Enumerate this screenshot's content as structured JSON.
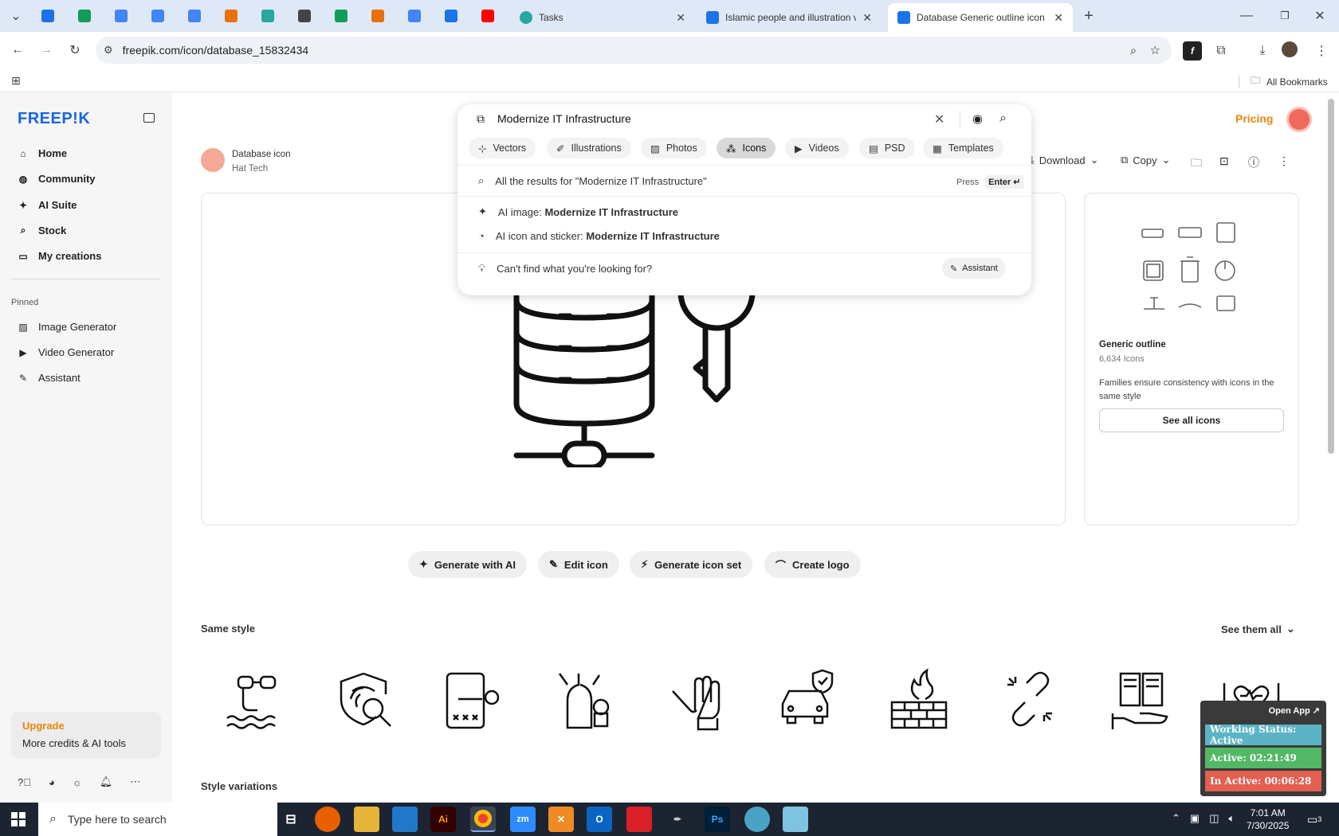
{
  "browser": {
    "tabs": [
      {
        "title": "Tasks",
        "color": "#27a7a0"
      },
      {
        "title": "Islamic people and illustration v",
        "color": "#1a73e8"
      },
      {
        "title": "Database Generic outline icon |",
        "color": "#1a73e8",
        "active": true
      }
    ],
    "pinned_tab_colors": [
      "#1a73e8",
      "#0f9d58",
      "#4285f4",
      "#4285f4",
      "#4285f4",
      "#e8710a",
      "#27a7a0",
      "#444444",
      "#0f9d58",
      "#e8710a",
      "#4285f4",
      "#1a73e8",
      "#ff0000"
    ],
    "url": "freepik.com/icon/database_15832434",
    "all_bookmarks": "All Bookmarks"
  },
  "sidebar": {
    "logo": "FREEP!K",
    "items": [
      {
        "label": "Home",
        "icon": "home-icon"
      },
      {
        "label": "Community",
        "icon": "globe-icon"
      },
      {
        "label": "AI Suite",
        "icon": "sparkle-icon"
      },
      {
        "label": "Stock",
        "icon": "search-icon"
      },
      {
        "label": "My creations",
        "icon": "folder-icon"
      }
    ],
    "pinned_label": "Pinned",
    "pinned": [
      {
        "label": "Image Generator",
        "icon": "image-icon"
      },
      {
        "label": "Video Generator",
        "icon": "video-icon"
      },
      {
        "label": "Assistant",
        "icon": "assistant-icon"
      }
    ],
    "upgrade_title": "Upgrade",
    "upgrade_text": "More credits & AI tools"
  },
  "header": {
    "pricing": "Pricing"
  },
  "asset": {
    "title": "Database icon",
    "author": "Hat Tech",
    "download": "Download",
    "copy": "Copy"
  },
  "search": {
    "query": "Modernize IT Infrastructure",
    "chips": [
      "Vectors",
      "Illustrations",
      "Photos",
      "Icons",
      "Videos",
      "PSD",
      "Templates"
    ],
    "selected_chip": "Icons",
    "all_results": "All the results for \"Modernize IT Infrastructure\"",
    "press": "Press",
    "enter": "Enter ↵",
    "ai_image_prefix": "AI image:",
    "ai_image_term": "Modernize IT Infrastructure",
    "ai_icon_prefix": "AI icon and sticker:",
    "ai_icon_term": "Modernize IT Infrastructure",
    "cant_find": "Can't find what you're looking for?",
    "assistant": "Assistant"
  },
  "family": {
    "name": "Generic outline",
    "count": "6,634 Icons",
    "description": "Families ensure consistency with icons in the same style",
    "see_all": "See all icons"
  },
  "actions": [
    "Generate with AI",
    "Edit icon",
    "Generate icon set",
    "Create logo"
  ],
  "same_style": {
    "title": "Same style",
    "see_all": "See them all",
    "icons": [
      "pipe-icon",
      "fingerprint-shield-icon",
      "phone-key-icon",
      "cooking-icon",
      "gloves-icon",
      "car-shield-icon",
      "firewall-icon",
      "broken-chain-icon",
      "book-hand-icon",
      "heart-hands-icon"
    ]
  },
  "style_variations": "Style variations",
  "taskbar": {
    "search_placeholder": "Type here to search",
    "time": "7:01 AM",
    "date": "7/30/2025",
    "notifications": "3"
  },
  "widget": {
    "open_app": "Open App ↗",
    "working_status": "Working Status: Active",
    "active": "Active: 02:21:49",
    "inactive": "In Active: 00:06:28",
    "colors": {
      "status": "#5ab4c5",
      "active": "#52b865",
      "inactive": "#e35f4f"
    }
  }
}
